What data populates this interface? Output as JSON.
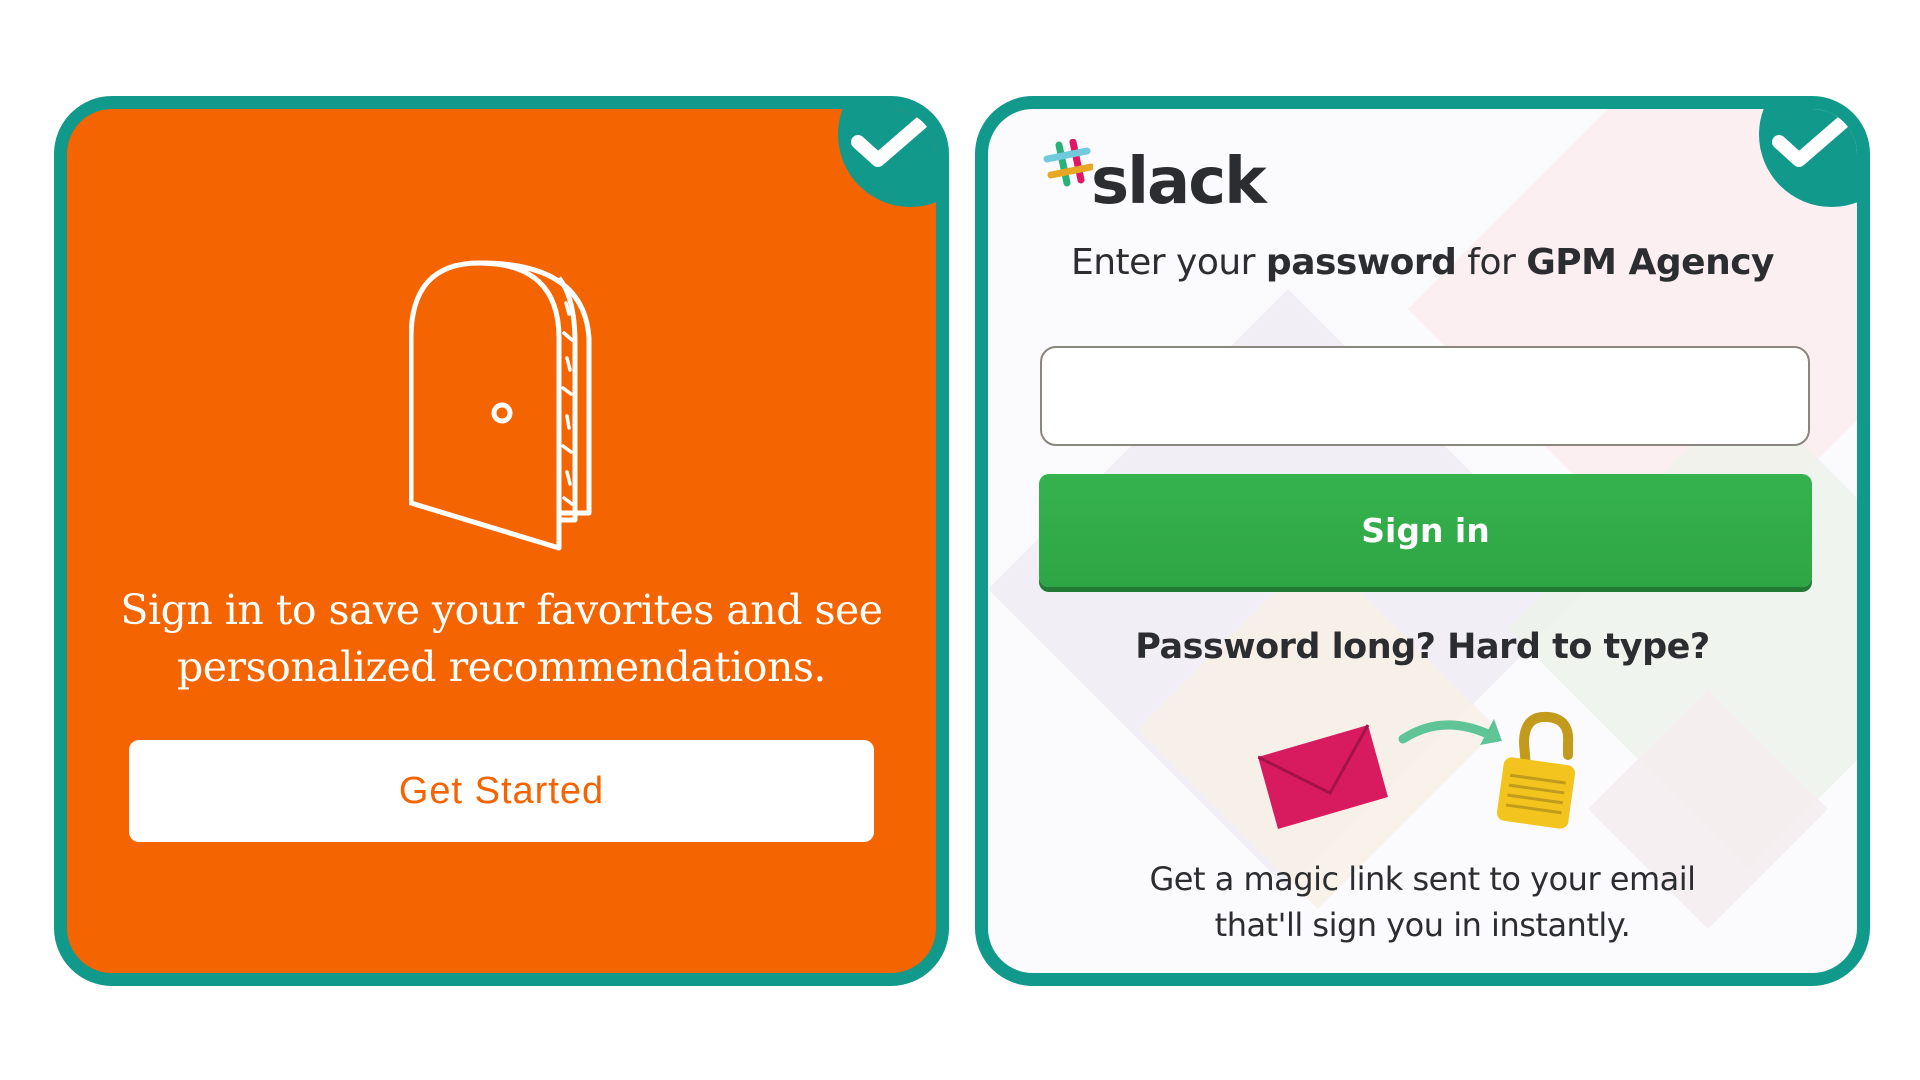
{
  "left_card": {
    "message": "Sign in to save your favorites and see personalized recommendations.",
    "button_label": "Get Started",
    "background_color": "#f46400",
    "icon": "door-icon"
  },
  "right_card": {
    "brand": "slack",
    "heading": {
      "part1": "Enter your ",
      "part2": "password",
      "part3": " for ",
      "part4": "GPM Agency"
    },
    "password_value": "",
    "signin_label": "Sign in",
    "signin_color": "#2ea643",
    "subheading": "Password long? Hard to type?",
    "magic_text_line1": "Get a magic link sent to your email",
    "magic_text_line2": "that'll sign you in instantly.",
    "illustration_icons": [
      "envelope-icon",
      "arrow-icon",
      "unlocked-padlock-icon"
    ]
  },
  "frame_color": "#11998b",
  "badge_icon": "checkmark-icon"
}
